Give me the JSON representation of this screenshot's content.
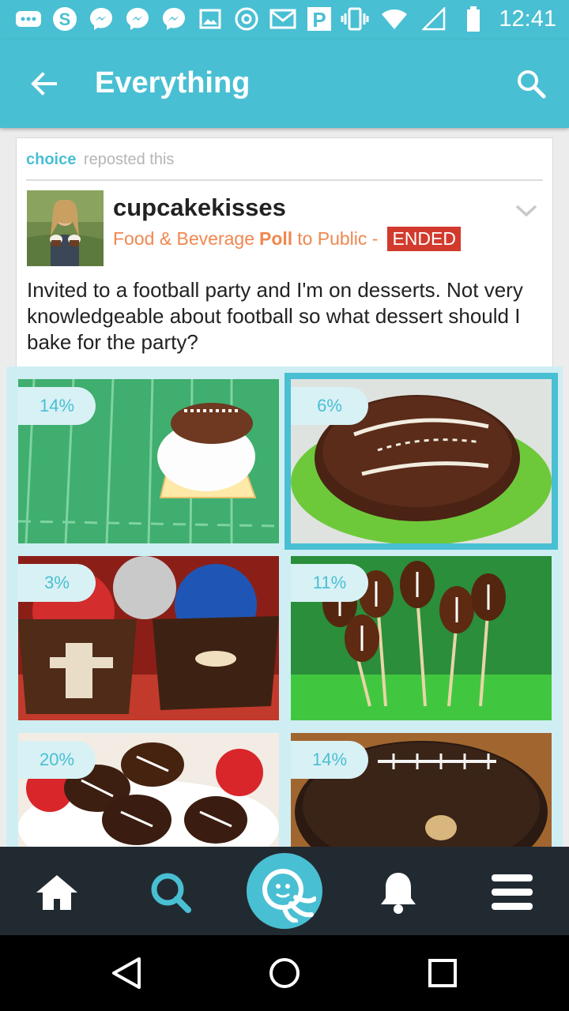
{
  "status_bar": {
    "time": "12:41",
    "notification_icons": [
      "more-icon",
      "skype-icon",
      "messenger-icon",
      "messenger-icon",
      "messenger-icon",
      "image-icon",
      "at-sign-icon",
      "gmail-icon",
      "parking-icon"
    ],
    "system_icons": [
      "vibrate-icon",
      "wifi-icon",
      "signal-icon",
      "battery-icon"
    ]
  },
  "app_bar": {
    "title": "Everything"
  },
  "post": {
    "repost_user": "choice",
    "repost_text": "reposted this",
    "author": "cupcakekisses",
    "category": "Food & Beverage",
    "type": "Poll",
    "audience": "to Public -",
    "status": "ENDED",
    "question": "Invited to a football party and I'm on desserts. Not very knowledgeable about football so what dessert should I bake for the party?"
  },
  "poll": {
    "options": [
      {
        "percent": "14%",
        "selected": false,
        "subject": "football cupcake on field"
      },
      {
        "percent": "6%",
        "selected": true,
        "subject": "chocolate football cake on green coconut"
      },
      {
        "percent": "3%",
        "selected": false,
        "subject": "helmet cupcakes in football wrappers"
      },
      {
        "percent": "11%",
        "selected": false,
        "subject": "chocolate football cake pops"
      },
      {
        "percent": "20%",
        "selected": false,
        "subject": "chocolate dipped football strawberries"
      },
      {
        "percent": "14%",
        "selected": false,
        "subject": "football cheese ball with sprinkles"
      }
    ]
  },
  "bottom_nav": [
    "home-icon",
    "search-icon",
    "octopus-logo-icon",
    "bell-icon",
    "menu-icon"
  ],
  "colors": {
    "accent": "#49bfd3",
    "orange": "#f0874f",
    "ended_red": "#d23a2d",
    "nav_dark": "#222a31"
  }
}
